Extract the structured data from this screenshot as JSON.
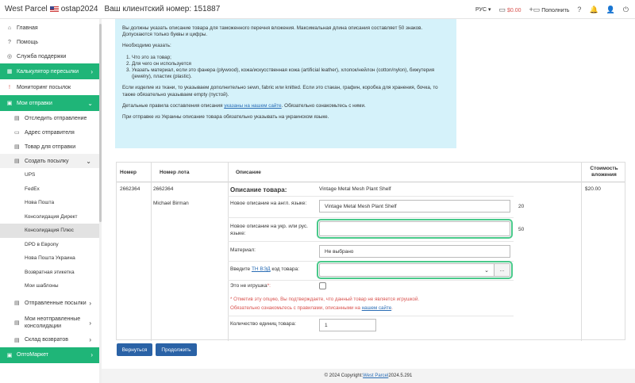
{
  "header": {
    "brand": "West Parcel",
    "username": "ostap2024",
    "client_number": "Ваш клиентский номер: 151887",
    "language": "РУС",
    "balance": "$0.00",
    "topup": "Пополнить",
    "help_icon": "?"
  },
  "sidebar": {
    "items": [
      {
        "label": "Главная",
        "icon": "home-icon",
        "glyph": "⌂"
      },
      {
        "label": "Помощь",
        "icon": "question-icon",
        "glyph": "?"
      },
      {
        "label": "Служба поддержки",
        "icon": "support-icon",
        "glyph": "◎"
      },
      {
        "label": "Калькулятор пересылки",
        "icon": "calculator-icon",
        "glyph": "▦"
      },
      {
        "label": "Мониторинг посылок",
        "icon": "alert-icon",
        "glyph": "!"
      },
      {
        "label": "Мои отправки",
        "icon": "cart-icon",
        "glyph": "🛒"
      }
    ],
    "shipments_sub": [
      {
        "label": "Отследить отправление",
        "glyph": "▤"
      },
      {
        "label": "Адрес отправителя",
        "glyph": "▭"
      },
      {
        "label": "Товар для отправки",
        "glyph": "▤"
      },
      {
        "label": "Создать посылку",
        "glyph": "▤"
      }
    ],
    "create_sub": [
      "UPS",
      "FedEx",
      "Нова Пошта",
      "Консолидация Директ",
      "Консолидация Плюс",
      "DPD в Европу",
      "Нова Пошта Украина",
      "Возвратная этикетка",
      "Мои шаблоны"
    ],
    "sent": "Отправленные посылки",
    "unsent": "Мои неотправленные консолидации",
    "returns": "Склад возвратов",
    "optomarket": "ОптоМаркет"
  },
  "info": {
    "p1": "Вы должны указать описание товара для таможенного перечня вложения. Максимальная длина описания составляет 50 знаков. Допускаются только буквы и цифры.",
    "p2": "Необходимо указать:",
    "list": [
      "Что это за товар;",
      "Для чего он используется",
      "Указать материал, если это фанера (plywood), кожа/искусственная кожа (artificial leather), хлопок/нейлон (cotton/nylon), бижутерия (jewelry), пластик (plastic)."
    ],
    "p3": "Если изделие из ткани, то указываем дополнительно sewn, fabric или knitted. Если это стакан, графин, коробка для хранения, бочка, то также обязательно указываем empty (пустой).",
    "p4_pre": "Детальные правила составления описания ",
    "p4_link": "указаны на нашем сайте",
    "p4_post": ". Обязательно ознакомьтесь с ними.",
    "p5": "При отправке из Украины описание товара обязательно указывать на украинском языке."
  },
  "table": {
    "headers": {
      "number": "Номер",
      "lot": "Номер лота",
      "description": "Описание",
      "cost": "Стоимость вложения"
    },
    "row": {
      "number": "2662364",
      "lot": "2662364",
      "seller": "Michael Birman",
      "cost": "$20.00",
      "desc_title": "Описание товара:",
      "desc_value": "Vintage Metal Mesh Plant Shelf",
      "en_label": "Новое описание на англ. языке:",
      "en_value": "Vintage Metal Mesh Plant Shelf",
      "en_count": "20",
      "ua_label": "Новое описание на укр. или рус. языке:",
      "ua_value": "",
      "ua_count": "50",
      "material_label": "Материал:",
      "material_value": "Не выбрано",
      "tnved_pre": "Введите ",
      "tnved_link": "ТН ВЭД",
      "tnved_post": " код товара:",
      "tnved_value": "",
      "toy_label": "Это не игрушка",
      "note1": "* Отметив эту опцию, Вы подтверждаете, что данный товар не является игрушкой.",
      "note2_pre": "Обязательно ознакомьтесь с правилами, описанными на ",
      "note2_link": "нашем сайте",
      "note2_post": ".",
      "qty_label": "Количество единиц товара:",
      "qty_value": "1"
    }
  },
  "buttons": {
    "back": "Вернуться",
    "continue": "Продолжить"
  },
  "footer": {
    "pre": "© 2024 Copyright: ",
    "link": "West Parcel",
    "post": " 2024.5.291"
  }
}
